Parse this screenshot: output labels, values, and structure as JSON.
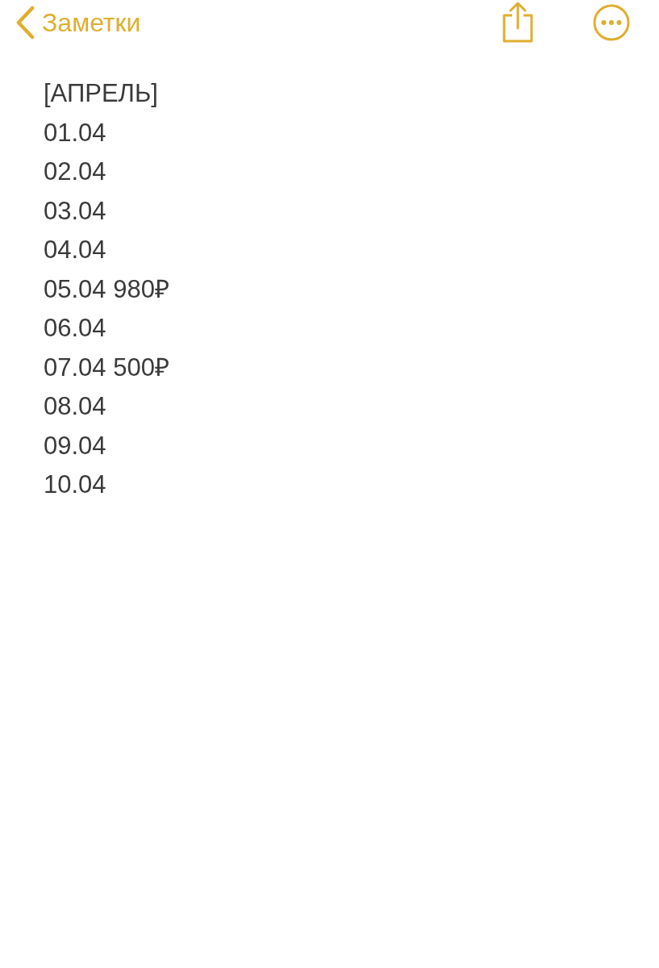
{
  "nav": {
    "back_label": "Заметки"
  },
  "note": {
    "lines": [
      "[АПРЕЛЬ]",
      "01.04",
      "02.04",
      "03.04",
      "04.04",
      "05.04 980₽",
      "06.04",
      "07.04 500₽",
      "08.04",
      "09.04",
      "10.04"
    ]
  }
}
